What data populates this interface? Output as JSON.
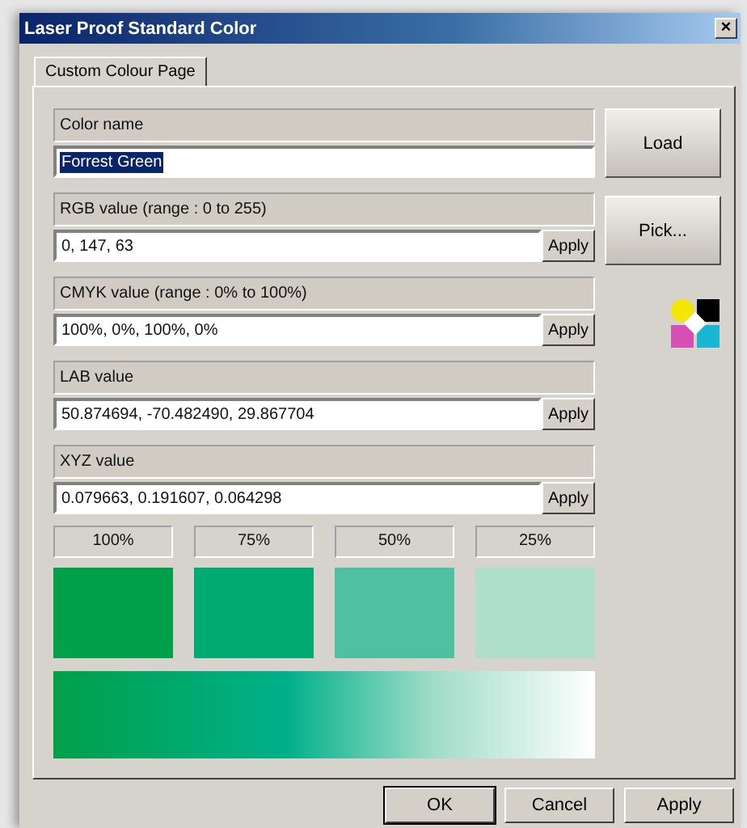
{
  "window": {
    "title": "Laser Proof Standard Color",
    "close": "×"
  },
  "tabs": [
    {
      "label": "Custom Colour Page",
      "selected": true
    }
  ],
  "fields": [
    {
      "kind": "name",
      "label": "Color name",
      "value": "Forrest Green",
      "selected": true
    },
    {
      "kind": "apply",
      "label": "RGB value (range : 0 to 255)",
      "value": "0, 147, 63",
      "apply": "Apply",
      "selected": false
    },
    {
      "kind": "apply",
      "label": "CMYK value (range : 0% to 100%)",
      "value": "100%, 0%, 100%, 0%",
      "apply": "Apply",
      "selected": false
    },
    {
      "kind": "apply",
      "label": "LAB value",
      "value": "50.874694, -70.482490, 29.867704",
      "apply": "Apply",
      "selected": false
    },
    {
      "kind": "apply",
      "label": "XYZ value",
      "value": "0.079663, 0.191607, 0.064298",
      "apply": "Apply",
      "selected": false
    }
  ],
  "side_buttons": [
    "Load",
    "Pick..."
  ],
  "swatches": [
    {
      "label": "100%",
      "color": "#00a04a"
    },
    {
      "label": "75%",
      "color": "#00ab72"
    },
    {
      "label": "50%",
      "color": "#50c1a0"
    },
    {
      "label": "25%",
      "color": "#afdfca"
    }
  ],
  "buttons": [
    {
      "label": "OK",
      "default": true
    },
    {
      "label": "Cancel",
      "default": false
    },
    {
      "label": "Apply",
      "default": false
    }
  ]
}
